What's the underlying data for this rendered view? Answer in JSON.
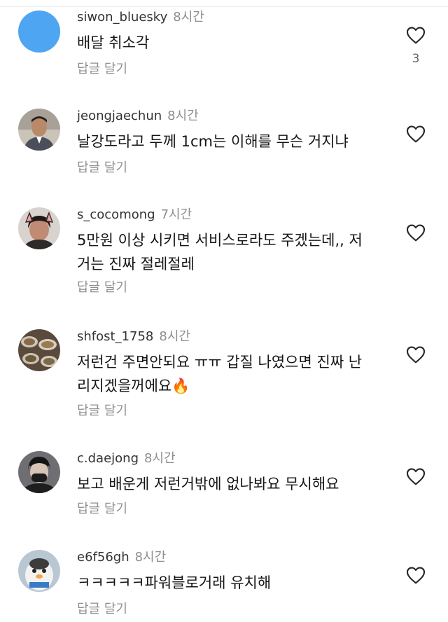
{
  "comments": [
    {
      "username": "siwon_bluesky",
      "time": "8시간",
      "text": "배달 취소각",
      "reply_label": "답글 달기",
      "like_count": "3",
      "avatar": "blue-circle"
    },
    {
      "username": "jeongjaechun",
      "time": "8시간",
      "text": "날강도라고 두께 1cm는 이해를 무슨 거지냐",
      "reply_label": "답글 달기",
      "avatar": "man-portrait"
    },
    {
      "username": "s_cocomong",
      "time": "7시간",
      "text": "5만원 이상 시키면 서비스로라도 주겠는데,, 저거는 진짜 절레절레",
      "reply_label": "답글 달기",
      "avatar": "cat-ears-portrait"
    },
    {
      "username": "shfost_1758",
      "time": "8시간",
      "text": "저런건 주면안되요 ㅠㅠ 갑질 나였으면 진짜 난리지겠을꺼에요🔥",
      "reply_label": "답글 달기",
      "avatar": "food-plates"
    },
    {
      "username": "c.daejong",
      "time": "8시간",
      "text": "보고 배운게 저런거밖에 없나봐요 무시해요",
      "reply_label": "답글 달기",
      "avatar": "masked-person"
    },
    {
      "username": "e6f56gh",
      "time": "8시간",
      "text": "ㅋㅋㅋㅋㅋ파워블로거래 유치해",
      "reply_label": "답글 달기",
      "avatar": "cartoon-character"
    }
  ],
  "icons": {
    "like": "heart-outline-icon"
  },
  "colors": {
    "username": "#333333",
    "meta": "#8e8e8e",
    "text": "#151515",
    "avatar_blue": "#4ea5f2"
  }
}
